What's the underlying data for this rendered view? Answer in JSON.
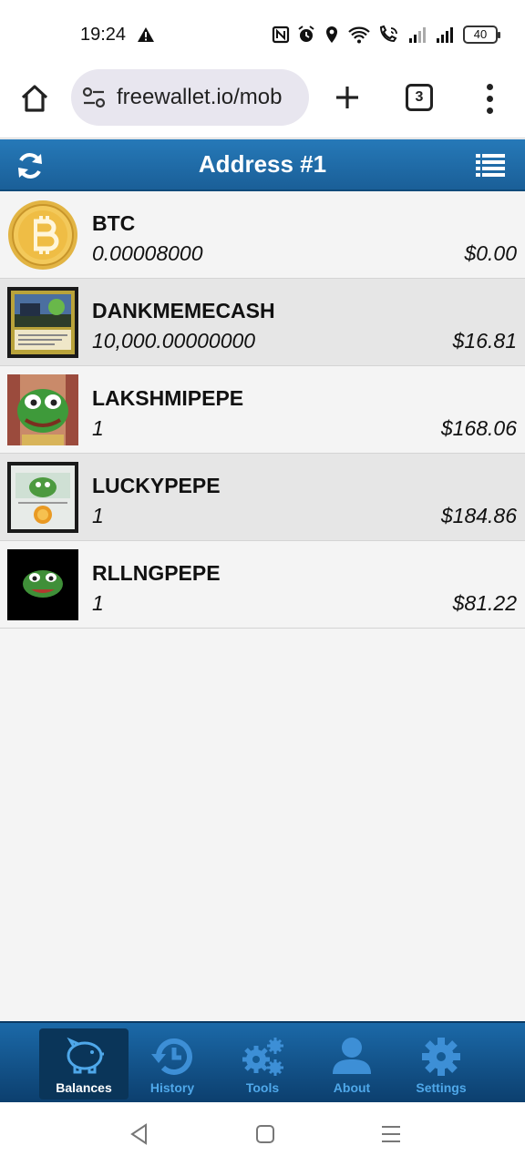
{
  "status_bar": {
    "time": "19:24",
    "battery": "40",
    "icons": [
      "warning-icon",
      "nfc-icon",
      "alarm-icon",
      "location-icon",
      "wifi-icon",
      "wifi-call-icon",
      "signal-icon",
      "signal-icon",
      "battery-icon"
    ]
  },
  "browser": {
    "url": "freewallet.io/mob",
    "tab_count": "3"
  },
  "header": {
    "title": "Address #1"
  },
  "assets": [
    {
      "name": "BTC",
      "quantity": "0.00008000",
      "value": "$0.00"
    },
    {
      "name": "DANKMEMECASH",
      "quantity": "10,000.00000000",
      "value": "$16.81"
    },
    {
      "name": "LAKSHMIPEPE",
      "quantity": "1",
      "value": "$168.06"
    },
    {
      "name": "LUCKYPEPE",
      "quantity": "1",
      "value": "$184.86"
    },
    {
      "name": "RLLNGPEPE",
      "quantity": "1",
      "value": "$81.22"
    }
  ],
  "nav": [
    {
      "label": "Balances",
      "icon": "piggy-bank-icon",
      "active": true
    },
    {
      "label": "History",
      "icon": "history-icon",
      "active": false
    },
    {
      "label": "Tools",
      "icon": "gears-icon",
      "active": false
    },
    {
      "label": "About",
      "icon": "user-icon",
      "active": false
    },
    {
      "label": "Settings",
      "icon": "gear-icon",
      "active": false
    }
  ],
  "colors": {
    "header_blue": "#2679b8",
    "nav_blue": "#1b69a8",
    "nav_label": "#4fa8ea",
    "nav_icon": "#3d8fd6"
  }
}
